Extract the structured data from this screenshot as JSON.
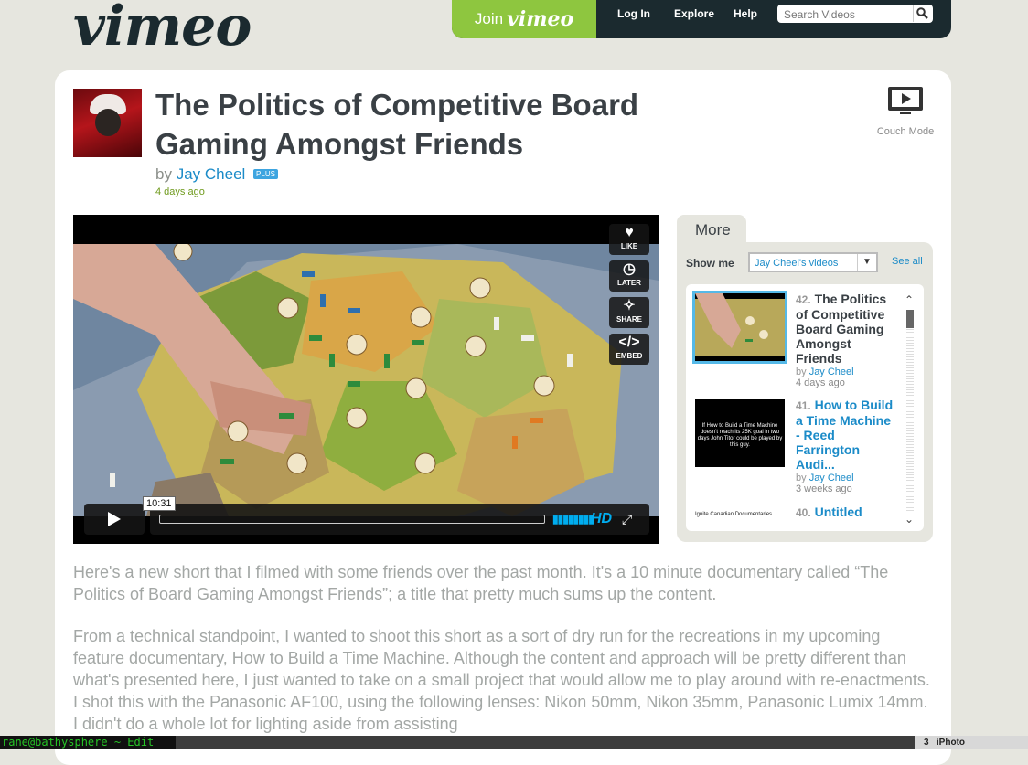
{
  "header": {
    "logo": "vimeo",
    "join_prefix": "Join",
    "join_brand": "vimeo",
    "nav": [
      "Log In",
      "Explore",
      "Help"
    ],
    "search_placeholder": "Search Videos"
  },
  "video": {
    "title": "The Politics of Competitive Board Gaming Amongst Friends",
    "by_label": "by",
    "author": "Jay Cheel",
    "badge": "PLUS",
    "posted": "4 days ago",
    "couch_mode": "Couch Mode"
  },
  "player": {
    "timecode": "10:31",
    "hd_label": "HD",
    "side_buttons": [
      {
        "label": "LIKE",
        "icon": "heart-icon"
      },
      {
        "label": "LATER",
        "icon": "clock-icon"
      },
      {
        "label": "SHARE",
        "icon": "share-icon"
      },
      {
        "label": "EMBED",
        "icon": "embed-icon"
      }
    ]
  },
  "more": {
    "tab": "More",
    "show_me": "Show me",
    "selected": "Jay Cheel's videos",
    "see_all": "See all",
    "items": [
      {
        "num": "42.",
        "title": "The Politics of Competitive Board Gaming Amongst Friends",
        "by": "by",
        "author": "Jay Cheel",
        "when": "4 days ago"
      },
      {
        "num": "41.",
        "title": "How to Build a Time Machine - Reed Farrington Audi...",
        "by": "by",
        "author": "Jay Cheel",
        "when": "3 weeks ago",
        "thumb_text": "If How to Build a Time Machine doesn't reach its 25K goal in two days John Titor could be played by this guy."
      },
      {
        "num": "40.",
        "title": "Untitled",
        "thumb_text": "Ignite Canadian Documentaries"
      }
    ]
  },
  "description": [
    "Here's a new short that I filmed with some friends over the past month. It's a 10 minute documentary called “The Politics of Board Gaming Amongst Friends”; a title that pretty much sums up the content.",
    "From a technical standpoint, I wanted to shoot this short as a sort of dry run for the recreations in my upcoming feature documentary, How to Build a Time Machine. Although the content and approach will be pretty different than what's presented here, I just wanted to take on a small project that would allow me to play around with re-enactments. I shot this with the Panasonic AF100, using the following lenses: Nikon 50mm, Nikon 35mm, Panasonic Lumix 14mm. I didn't do a whole lot for lighting aside from assisting"
  ],
  "taskbar": {
    "terminal": "rane@bathysphere ~ Edit",
    "iphoto_num": "3",
    "iphoto": "iPhoto"
  },
  "colors": {
    "brand_green": "#8ec63f",
    "link_blue": "#1b8bc8",
    "hd_blue": "#00adef",
    "header_dark": "#1b2a2f"
  }
}
